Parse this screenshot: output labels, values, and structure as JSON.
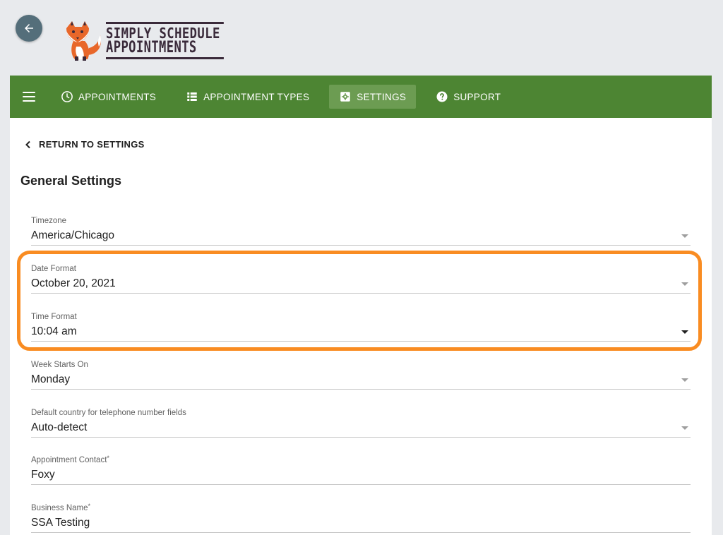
{
  "logo": {
    "line1": "SIMPLY SCHEDULE",
    "line2": "APPOINTMENTS"
  },
  "nav": {
    "items": [
      {
        "label": "APPOINTMENTS",
        "icon": "clock-icon"
      },
      {
        "label": "APPOINTMENT TYPES",
        "icon": "list-icon"
      },
      {
        "label": "SETTINGS",
        "icon": "settings-icon"
      },
      {
        "label": "SUPPORT",
        "icon": "help-circle-icon"
      }
    ],
    "active": "SETTINGS"
  },
  "content": {
    "return_label": "RETURN TO SETTINGS",
    "title": "General Settings"
  },
  "fields": [
    {
      "label": "Timezone",
      "value": "America/Chicago",
      "type": "select"
    },
    {
      "label": "Date Format",
      "value": "October 20, 2021",
      "type": "select"
    },
    {
      "label": "Time Format",
      "value": "10:04 am",
      "type": "select"
    },
    {
      "label": "Week Starts On",
      "value": "Monday",
      "type": "select"
    },
    {
      "label": "Default country for telephone number fields",
      "value": "Auto-detect",
      "type": "select"
    },
    {
      "label": "Appointment Contact",
      "required": "*",
      "value": "Foxy",
      "type": "input"
    },
    {
      "label": "Business Name",
      "required": "*",
      "value": "SSA Testing",
      "type": "input"
    }
  ],
  "colors": {
    "nav_bg": "#4d8533",
    "nav_active_bg": "#6c9c52",
    "highlight": "#f98c22",
    "back_button": "#546e7a",
    "page_bg": "#e8eaed"
  }
}
